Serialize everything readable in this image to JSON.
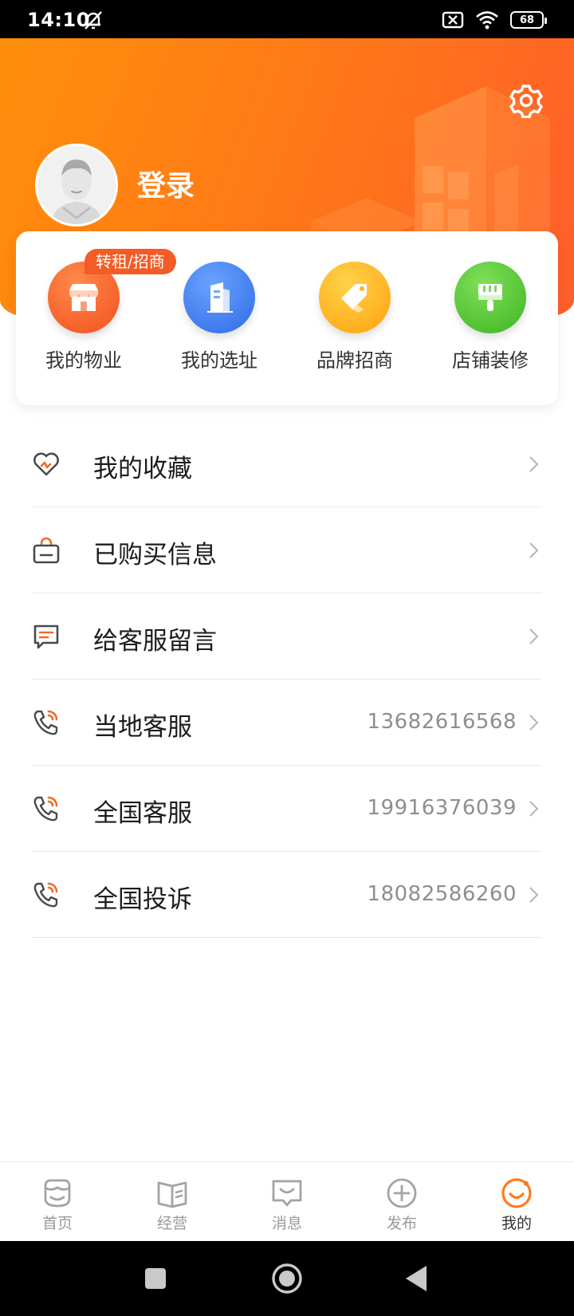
{
  "status_bar": {
    "time": "14:10",
    "battery": "68"
  },
  "header": {
    "login_label": "登录"
  },
  "quick_actions": {
    "badge": "转租/招商",
    "items": [
      {
        "label": "我的物业",
        "color": "#f4592a"
      },
      {
        "label": "我的选址",
        "color": "#3f7ff0"
      },
      {
        "label": "品牌招商",
        "color": "#ffad14"
      },
      {
        "label": "店铺装修",
        "color": "#4fc52c"
      }
    ]
  },
  "menu": [
    {
      "label": "我的收藏",
      "value": ""
    },
    {
      "label": "已购买信息",
      "value": ""
    },
    {
      "label": "给客服留言",
      "value": ""
    },
    {
      "label": "当地客服",
      "value": "13682616568"
    },
    {
      "label": "全国客服",
      "value": "19916376039"
    },
    {
      "label": "全国投诉",
      "value": "18082586260"
    }
  ],
  "tabbar": [
    {
      "label": "首页",
      "active": false
    },
    {
      "label": "经营",
      "active": false
    },
    {
      "label": "消息",
      "active": false
    },
    {
      "label": "发布",
      "active": false
    },
    {
      "label": "我的",
      "active": true
    }
  ],
  "colors": {
    "accent": "#ff7a1a",
    "icon_orange": "#f46a24",
    "icon_gray": "#4a4a4a"
  }
}
